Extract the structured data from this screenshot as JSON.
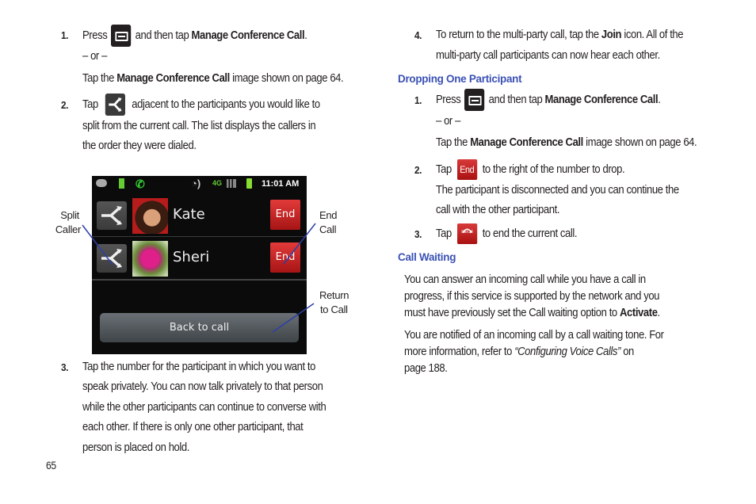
{
  "left_column": {
    "step1": {
      "number": "1.",
      "press": "Press",
      "icon": "menu-key-icon",
      "and_then_tap": "and then tap",
      "bold": "Manage Conference Call",
      "period": ".",
      "or": "– or –",
      "alt_tap": "Tap the",
      "alt_bold": "Manage Conference Call",
      "alt_rest": "image shown on page 64."
    },
    "step2": {
      "number": "2.",
      "tap": "Tap",
      "icon": "split-call-icon",
      "line1": "adjacent to the participants you would like to",
      "line2": "split from the current call. The list displays the callers in",
      "line3": "the order they were dialed."
    },
    "step3": {
      "number": "3.",
      "lines": [
        "Tap the number for the participant in which you want to",
        "speak privately. You can now talk privately to that person",
        "while the other participants can continue to converse with",
        "each other. If there is only one other participant, that",
        "person is placed on hold."
      ]
    },
    "page_number": "65"
  },
  "screenshot": {
    "status_time": "11:01 AM",
    "participants": [
      {
        "name": "Kate",
        "end_label": "End"
      },
      {
        "name": "Sheri",
        "end_label": "End"
      }
    ],
    "back_button": "Back to call",
    "callouts": {
      "split_line1": "Split",
      "split_line2": "Caller",
      "end_line1": "End",
      "end_line2": "Call",
      "return_line1": "Return",
      "return_line2": "to Call"
    }
  },
  "right_column": {
    "step4": {
      "number": "4.",
      "line1_pre": "To return to the multi-party call, tap the",
      "line1_bold": "Join",
      "line1_post": "icon. All of the",
      "line2": "multi-party call participants can now hear each other."
    },
    "heading_drop": "Dropping One Participant",
    "drop_step1": {
      "number": "1.",
      "press": "Press",
      "and_then_tap": "and then tap",
      "bold": "Manage Conference Call",
      "period": ".",
      "or": "– or –",
      "alt_tap": "Tap the",
      "alt_bold": "Manage Conference Call",
      "alt_rest": "image shown on page 64."
    },
    "drop_step2": {
      "number": "2.",
      "tap": "Tap",
      "end_label": "End",
      "rest": "to the right of the number to drop.",
      "line2": "The participant is disconnected and you can continue the",
      "line3": "call with the other participant."
    },
    "drop_step3": {
      "number": "3.",
      "tap": "Tap",
      "end_call_label": "End Call",
      "rest": "to end the current call."
    },
    "heading_waiting": "Call Waiting",
    "para1": {
      "line1": "You can answer an incoming call while you have a call in",
      "line2": "progress, if this service is supported by the network and you",
      "line3_pre": "must have previously set the Call waiting option to",
      "line3_bold": "Activate",
      "line3_post": "."
    },
    "para2": {
      "line1": "You are notified of an incoming call by a call waiting tone. For",
      "line2_pre": "more information, refer to",
      "line2_italic": "“Configuring Voice Calls”",
      "line2_post": "on",
      "line3": "page 188."
    }
  },
  "colors": {
    "heading_blue": "#3a51b4",
    "callout_line": "#2b3fa8",
    "end_red": "#c62020"
  }
}
